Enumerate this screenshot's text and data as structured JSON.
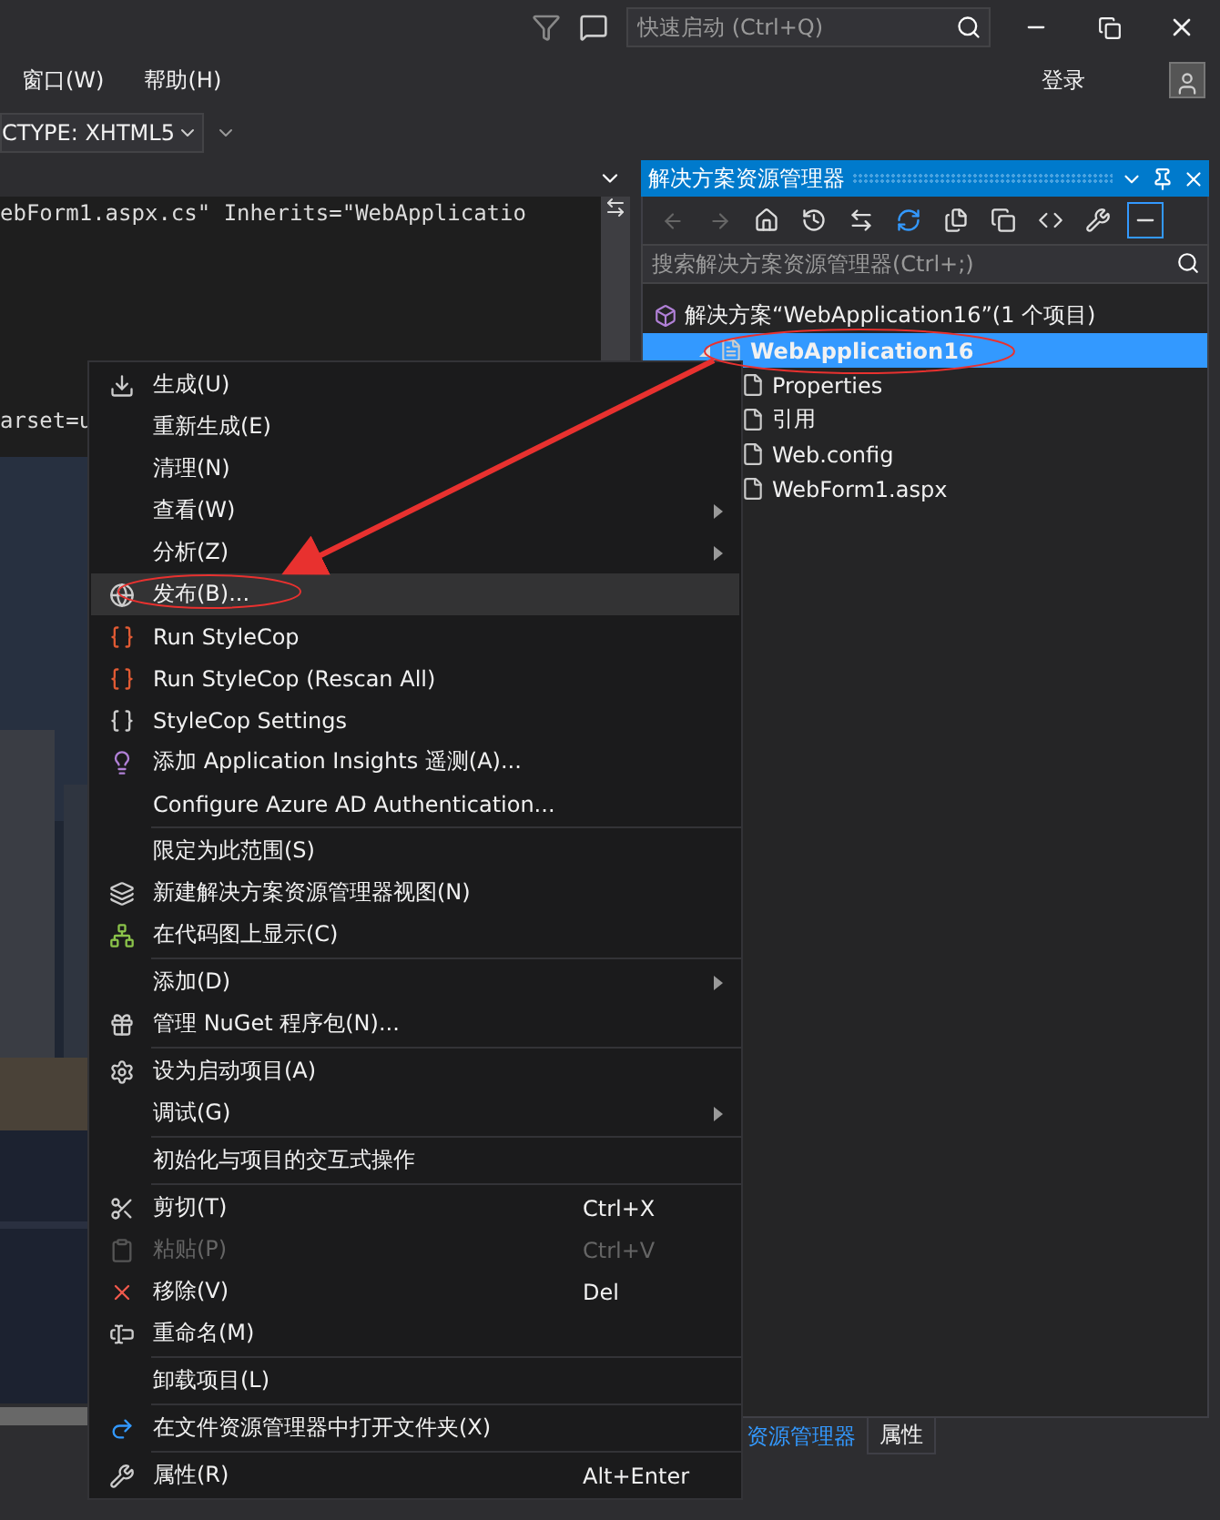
{
  "title_bar": {
    "quick_launch": {
      "placeholder": "快速启动 (Ctrl+Q)"
    }
  },
  "menu_bar": {
    "items": [
      "窗口(W)",
      "帮助(H)"
    ],
    "sign_in": "登录"
  },
  "toolbar": {
    "doctype": "CTYPE: XHTML5"
  },
  "editor": {
    "lines": [
      "ebForm1.aspx.cs\" Inherits=\"WebApplicatio",
      "arset=u"
    ]
  },
  "solution_explorer": {
    "title": "解决方案资源管理器",
    "search": {
      "placeholder": "搜索解决方案资源管理器(Ctrl+;)"
    },
    "tree": [
      {
        "label": "解决方案“WebApplication16”(1 个项目)",
        "selected": false,
        "children": [
          {
            "label": "WebApplication16",
            "selected": true,
            "expanded": true,
            "children": [
              {
                "label": "Properties",
                "selected": false
              },
              {
                "label": "引用",
                "selected": false
              },
              {
                "label": "Web.config",
                "selected": false
              },
              {
                "label": "WebForm1.aspx",
                "selected": false
              }
            ]
          }
        ]
      }
    ],
    "tabs": [
      {
        "label": "资源管理器",
        "selected": true
      },
      {
        "label": "属性",
        "selected": false
      }
    ]
  },
  "context_menu": [
    {
      "kind": "item",
      "label": "生成(U)",
      "selected": false,
      "disabled": false
    },
    {
      "kind": "item",
      "label": "重新生成(E)",
      "selected": false,
      "disabled": false
    },
    {
      "kind": "item",
      "label": "清理(N)",
      "selected": false,
      "disabled": false
    },
    {
      "kind": "submenu",
      "label": "查看(W)",
      "selected": false,
      "disabled": false
    },
    {
      "kind": "submenu",
      "label": "分析(Z)",
      "selected": false,
      "disabled": false
    },
    {
      "kind": "item",
      "label": "发布(B)...",
      "selected": true,
      "disabled": false
    },
    {
      "kind": "item",
      "label": "Run StyleCop",
      "selected": false,
      "disabled": false
    },
    {
      "kind": "item",
      "label": "Run StyleCop (Rescan All)",
      "selected": false,
      "disabled": false
    },
    {
      "kind": "item",
      "label": "StyleCop Settings",
      "selected": false,
      "disabled": false
    },
    {
      "kind": "item",
      "label": "添加 Application Insights 遥测(A)...",
      "selected": false,
      "disabled": false
    },
    {
      "kind": "item",
      "label": "Configure Azure AD Authentication...",
      "selected": false,
      "disabled": false
    },
    {
      "kind": "separator"
    },
    {
      "kind": "item",
      "label": "限定为此范围(S)",
      "selected": false,
      "disabled": false
    },
    {
      "kind": "item",
      "label": "新建解决方案资源管理器视图(N)",
      "selected": false,
      "disabled": false
    },
    {
      "kind": "item",
      "label": "在代码图上显示(C)",
      "selected": false,
      "disabled": false
    },
    {
      "kind": "separator"
    },
    {
      "kind": "submenu",
      "label": "添加(D)",
      "selected": false,
      "disabled": false
    },
    {
      "kind": "item",
      "label": "管理 NuGet 程序包(N)...",
      "selected": false,
      "disabled": false
    },
    {
      "kind": "separator"
    },
    {
      "kind": "item",
      "label": "设为启动项目(A)",
      "selected": false,
      "disabled": false
    },
    {
      "kind": "submenu",
      "label": "调试(G)",
      "selected": false,
      "disabled": false
    },
    {
      "kind": "separator"
    },
    {
      "kind": "item",
      "label": "初始化与项目的交互式操作",
      "selected": false,
      "disabled": false
    },
    {
      "kind": "separator"
    },
    {
      "kind": "item",
      "label": "剪切(T)",
      "shortcut": "Ctrl+X",
      "selected": false,
      "disabled": false
    },
    {
      "kind": "item",
      "label": "粘贴(P)",
      "shortcut": "Ctrl+V",
      "selected": false,
      "disabled": true
    },
    {
      "kind": "item",
      "label": "移除(V)",
      "shortcut": "Del",
      "selected": false,
      "disabled": false
    },
    {
      "kind": "item",
      "label": "重命名(M)",
      "selected": false,
      "disabled": false
    },
    {
      "kind": "separator"
    },
    {
      "kind": "item",
      "label": "卸载项目(L)",
      "selected": false,
      "disabled": false
    },
    {
      "kind": "separator"
    },
    {
      "kind": "item",
      "label": "在文件资源管理器中打开文件夹(X)",
      "selected": false,
      "disabled": false
    },
    {
      "kind": "separator"
    },
    {
      "kind": "item",
      "label": "属性(R)",
      "shortcut": "Alt+Enter",
      "selected": false,
      "disabled": false
    }
  ]
}
